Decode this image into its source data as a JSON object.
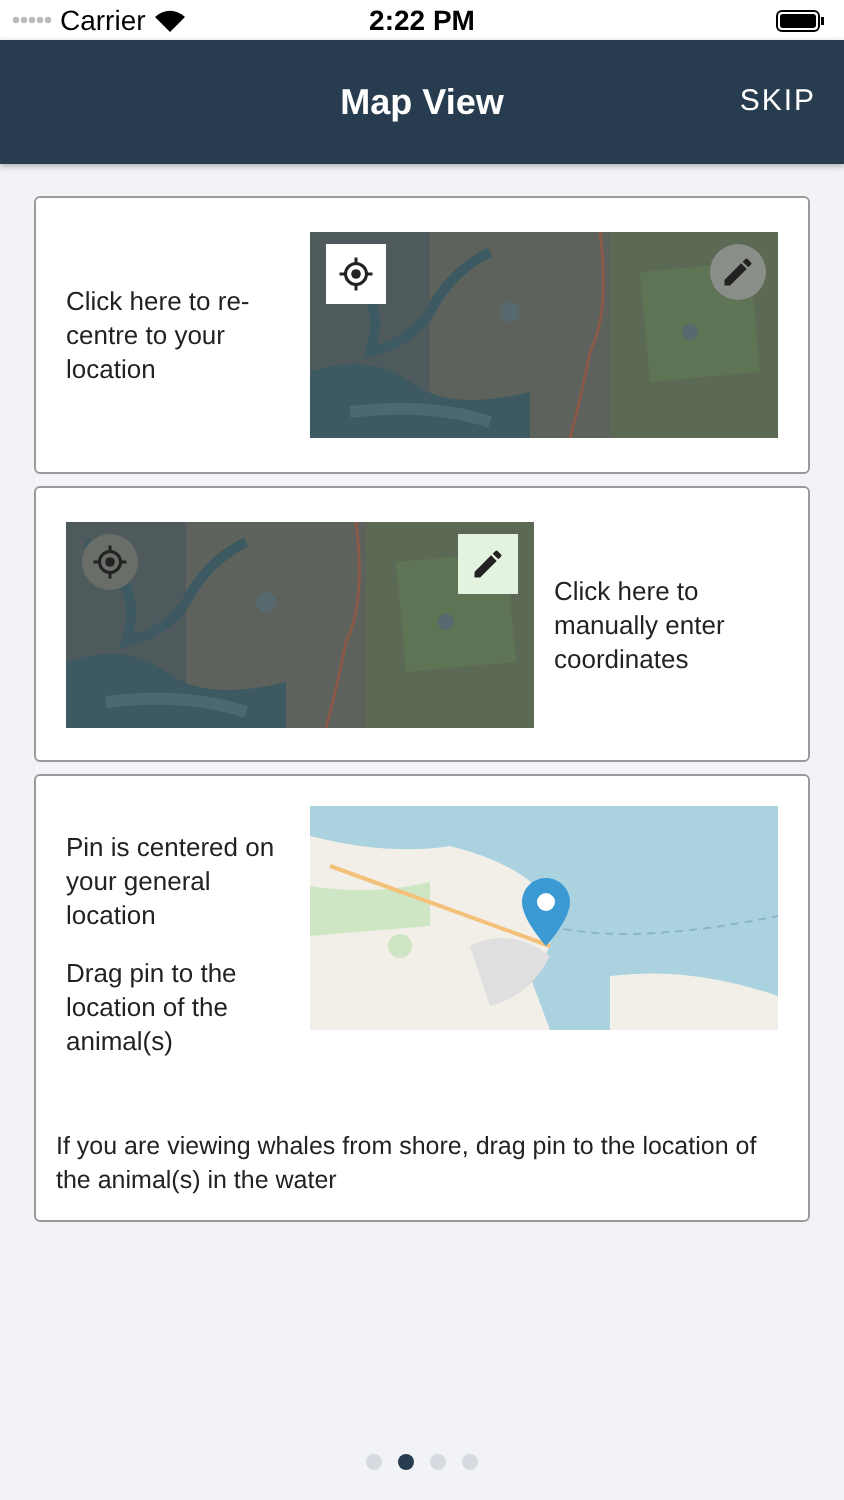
{
  "status_bar": {
    "carrier": "Carrier",
    "time": "2:22 PM"
  },
  "nav": {
    "title": "Map View",
    "action": "SKIP"
  },
  "cards": [
    {
      "kind": "recenter",
      "texts": [
        "Click here to re-centre to your location"
      ]
    },
    {
      "kind": "manual",
      "texts": [
        "Click here to manually enter coordinates"
      ]
    },
    {
      "kind": "pin",
      "texts": [
        "Pin is centered on your general location",
        "Drag pin to the location of the animal(s)"
      ],
      "note": "If you are viewing whales from shore, drag pin to the location of the animal(s) in the water"
    }
  ],
  "page_dots": [
    {
      "selected": false
    },
    {
      "selected": true
    },
    {
      "selected": false
    },
    {
      "selected": false
    }
  ]
}
